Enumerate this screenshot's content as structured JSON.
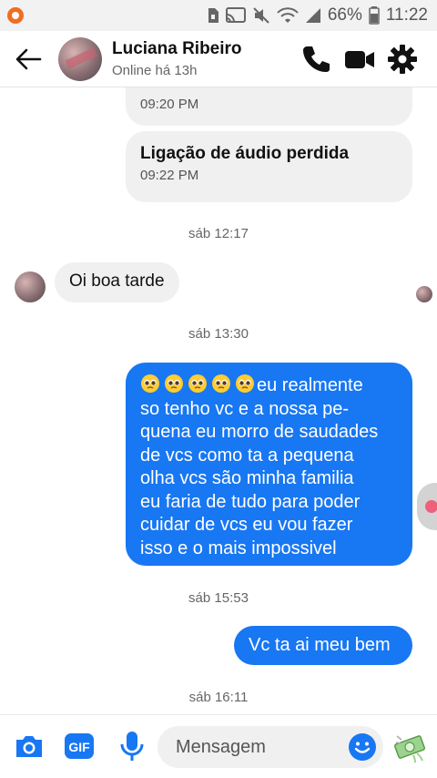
{
  "status_bar": {
    "battery": "66%",
    "time": "11:22"
  },
  "header": {
    "contact_name": "Luciana Ribeiro",
    "contact_status": "Online há 13h"
  },
  "messages": {
    "partial_call_time": "09:20 PM",
    "missed_call_title": "Ligação de áudio perdida",
    "missed_call_time": "09:22 PM",
    "ts1": "sáb 12:17",
    "incoming_text": "Oi boa tarde",
    "ts2": "sáb 13:30",
    "long_lines": [
      "eu realmente",
      "so tenho vc e a nossa pe-",
      "quena eu morro de saudades",
      "de vcs como ta a pequena",
      "olha vcs são minha familia",
      "eu faria de tudo para poder",
      "cuidar de vcs eu vou fazer",
      "isso e o mais impossivel"
    ],
    "ts3": "sáb 15:53",
    "short_text": "Vc ta ai meu bem",
    "ts4": "sáb 16:11"
  },
  "composer": {
    "placeholder": "Mensagem",
    "gif_label": "GIF"
  },
  "colors": {
    "accent": "#1877f2",
    "incoming_bubble": "#f0f0f0"
  },
  "icons": [
    "back-arrow-icon",
    "phone-icon",
    "video-icon",
    "gear-icon",
    "camera-icon",
    "gif-icon",
    "mic-icon",
    "smile-icon",
    "money-icon"
  ]
}
